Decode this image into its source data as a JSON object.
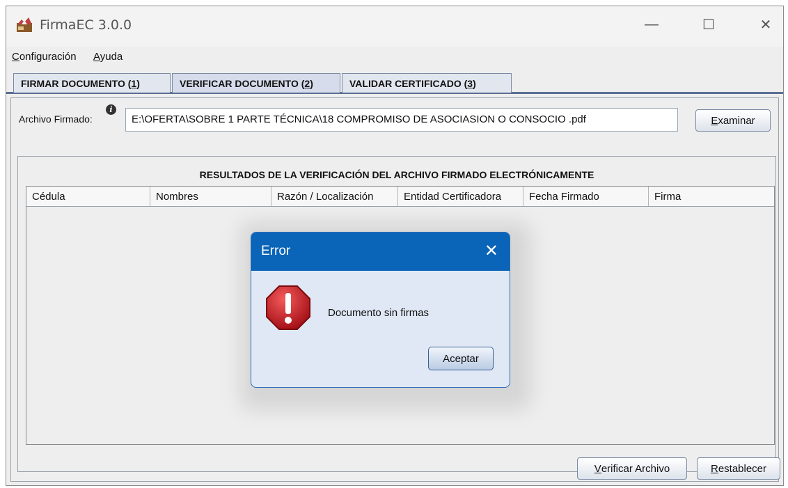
{
  "app": {
    "title": "FirmaEC 3.0.0"
  },
  "window_controls": {
    "minimize": "—",
    "maximize": "☐",
    "close": "✕"
  },
  "menu": [
    {
      "label": "Configuración",
      "mnemonic": "C",
      "rest": "onfiguración"
    },
    {
      "label": "Ayuda",
      "mnemonic": "A",
      "rest": "yuda"
    }
  ],
  "tabs": [
    {
      "label": "FIRMAR DOCUMENTO",
      "key": "1"
    },
    {
      "label": "VERIFICAR DOCUMENTO",
      "key": "2",
      "active": true
    },
    {
      "label": "VALIDAR CERTIFICADO",
      "key": "3"
    }
  ],
  "file": {
    "label": "Archivo Firmado:",
    "value": "E:\\OFERTA\\SOBRE 1 PARTE TÉCNICA\\18 COMPROMISO DE ASOCIASION O CONSOCIO .pdf",
    "browse_mnemonic": "E",
    "browse_rest": "xaminar"
  },
  "results": {
    "title": "RESULTADOS DE LA VERIFICACIÓN DEL ARCHIVO FIRMADO ELECTRÓNICAMENTE",
    "columns": [
      "Cédula",
      "Nombres",
      "Razón / Localización",
      "Entidad Certificadora",
      "Fecha Firmado",
      "Firma"
    ]
  },
  "bottom_buttons": {
    "verify_mnemonic": "V",
    "verify_rest": "erificar Archivo",
    "reset_mnemonic": "R",
    "reset_rest": "establecer"
  },
  "dialog": {
    "title": "Error",
    "message": "Documento sin firmas",
    "ok_label": "Aceptar"
  },
  "colors": {
    "dialog_title": "#0a64b8",
    "error_red": "#c8161d"
  }
}
